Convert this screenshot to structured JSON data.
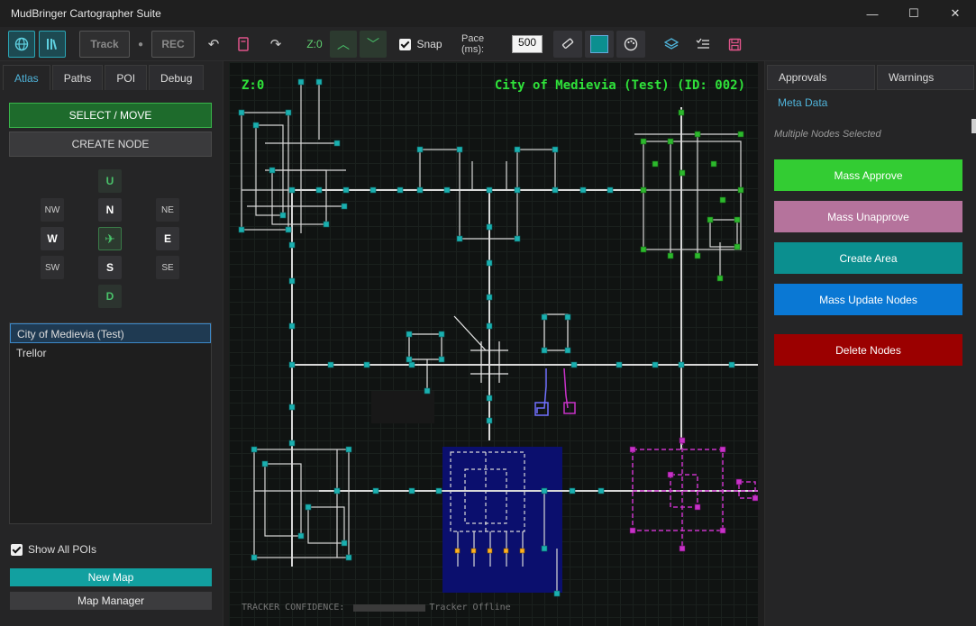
{
  "app": {
    "title": "MudBringer Cartographer Suite"
  },
  "window_controls": {
    "minimize": "—",
    "maximize": "☐",
    "close": "✕"
  },
  "toolbar": {
    "track_label": "Track",
    "rec_label": "REC",
    "dot": "●",
    "z_label": "Z:0",
    "snap_label": "Snap",
    "snap_checked": true,
    "pace_label": "Pace (ms):",
    "pace_value": "500"
  },
  "left_panel": {
    "tabs": [
      {
        "label": "Atlas",
        "active": true
      },
      {
        "label": "Paths"
      },
      {
        "label": "POI"
      },
      {
        "label": "Debug"
      }
    ],
    "select_move_label": "SELECT / MOVE",
    "create_node_label": "CREATE NODE",
    "directions": {
      "up": "U",
      "nw": "NW",
      "n": "N",
      "ne": "NE",
      "w": "W",
      "e": "E",
      "sw": "SW",
      "s": "S",
      "se": "SE",
      "down": "D"
    },
    "maps": [
      {
        "name": "City of Medievia (Test)",
        "selected": true
      },
      {
        "name": "Trellor"
      }
    ],
    "show_all_pois_label": "Show All POIs",
    "show_all_pois_checked": true,
    "new_map_label": "New Map",
    "map_manager_label": "Map Manager"
  },
  "map": {
    "z_label": "Z:0",
    "title": "City of Medievia (Test) (ID: 002)",
    "tracker_label": "TRACKER CONFIDENCE:",
    "tracker_status": "Tracker Offline"
  },
  "right_panel": {
    "tabs": [
      {
        "label": "Approvals"
      },
      {
        "label": "Warnings"
      },
      {
        "label": "Meta Data",
        "active": true
      }
    ],
    "selection_text": "Multiple Nodes Selected",
    "buttons": [
      {
        "label": "Mass Approve",
        "color": "#33cc33"
      },
      {
        "label": "Mass Unapprove",
        "color": "#b5739c"
      },
      {
        "label": "Create Area",
        "color": "#0b8f8f"
      },
      {
        "label": "Mass Update Nodes",
        "color": "#0a78d4"
      },
      {
        "label": "Delete Nodes",
        "color": "#9b0000"
      }
    ]
  },
  "colors": {
    "map_green": "#2fe23a",
    "node_teal": "#1ab0b0",
    "node_green": "#2db82d",
    "node_magenta": "#c832c8",
    "area_blue": "#0b0f6e"
  }
}
